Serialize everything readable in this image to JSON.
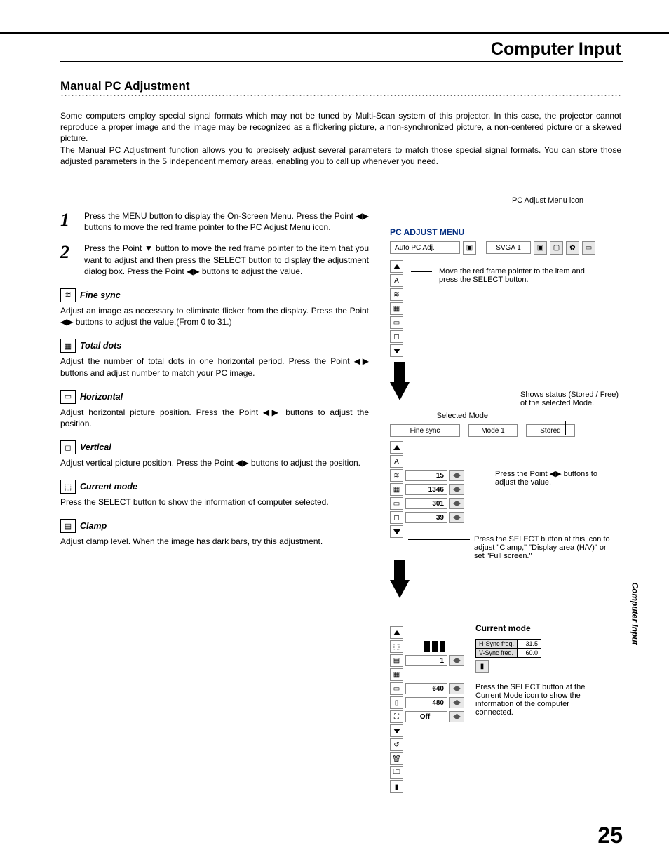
{
  "header": "Computer Input",
  "section_title": "Manual PC Adjustment",
  "intro_p1": "Some computers employ special signal formats which may not be tuned by Multi-Scan system of this projector.  In this case, the projector cannot reproduce a proper image and the image may be recognized as a flickering picture, a non-synchronized picture, a non-centered picture or a skewed picture.",
  "intro_p2": "The Manual PC Adjustment function allows you to precisely adjust several parameters to match those special signal formats. You can store those adjusted parameters in the 5 independent memory areas, enabling you to call up whenever you need.",
  "steps": [
    "Press the MENU button to display the On-Screen Menu. Press the Point ◀▶ buttons to move the red frame pointer to the PC Adjust Menu icon.",
    "Press the Point ▼ button to move the red frame pointer to the item that you want to adjust and then press the SELECT button to display the adjustment dialog box.  Press the Point ◀▶ buttons to adjust the value."
  ],
  "params": [
    {
      "title": "Fine sync",
      "desc": "Adjust an image as necessary to eliminate flicker from the display. Press the Point ◀▶ buttons to adjust the value.(From 0 to 31.)"
    },
    {
      "title": "Total dots",
      "desc": "Adjust the number of total dots in one horizontal period.  Press the Point ◀▶ buttons and adjust number to match your PC image."
    },
    {
      "title": "Horizontal",
      "desc": "Adjust horizontal picture position.  Press the Point ◀▶ buttons to adjust the position."
    },
    {
      "title": "Vertical",
      "desc": "Adjust vertical picture position.  Press the Point ◀▶ buttons to adjust the position."
    },
    {
      "title": "Current mode",
      "desc": "Press the SELECT button to show the information of computer selected."
    },
    {
      "title": "Clamp",
      "desc": "Adjust clamp level.  When the image has dark bars, try this adjustment."
    }
  ],
  "right": {
    "icon_caption": "PC Adjust Menu icon",
    "menu_title": "PC ADJUST MENU",
    "top_field": "Auto PC Adj.",
    "signal": "SVGA 1",
    "ann_move": "Move the red frame pointer to the item and press the SELECT button.",
    "selected_mode_label": "Selected Mode",
    "status_label": "Shows status (Stored / Free) of the selected Mode.",
    "sub_field": "Fine sync",
    "mode_field": "Mode 1",
    "stored_field": "Stored",
    "vals": [
      "15",
      "1346",
      "301",
      "39"
    ],
    "ann_adjust": "Press the Point ◀▶ buttons to adjust the value.",
    "ann_clamp": "Press the SELECT button at this icon to adjust \"Clamp,\" \"Display area (H/V)\" or set \"Full screen.\"",
    "cm_title": "Current mode",
    "freq": [
      {
        "l": "H-Sync freq.",
        "v": "31.5"
      },
      {
        "l": "V-Sync freq.",
        "v": "60.0"
      }
    ],
    "vals2": [
      "1",
      "640",
      "480",
      "Off"
    ],
    "ann_cm": "Press the SELECT button at the Current Mode icon to show the information of the computer connected."
  },
  "side_tab": "Computer Input",
  "page_num": "25"
}
